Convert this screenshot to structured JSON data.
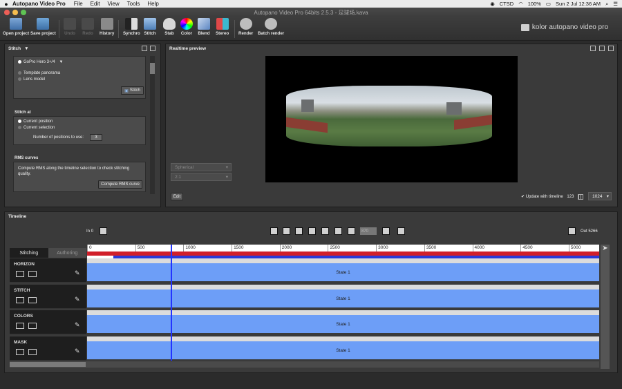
{
  "menubar": {
    "app_name": "Autopano Video Pro",
    "items": [
      "File",
      "Edit",
      "View",
      "Tools",
      "Help"
    ],
    "status_ctsd": "CTSD",
    "battery": "100%",
    "clock": "Sun 2 Jul  12:36 AM"
  },
  "window_title": "Autopano Video Pro 64bits 2.5.3 - 足球场.kava",
  "toolbar": {
    "open_project": "Open project",
    "save_project": "Save project",
    "undo": "Undo",
    "redo": "Redo",
    "history": "History",
    "synchro": "Synchro",
    "stitch": "Stitch",
    "stab": "Stab",
    "color": "Color",
    "blend": "Blend",
    "stereo": "Stereo",
    "render": "Render",
    "batch_render": "Batch render",
    "brand": "kolor autopano video pro"
  },
  "stitch_panel": {
    "title": "Stitch",
    "preset": "GoPro Hero 3+/4",
    "template_panorama": "Template panorama",
    "lens_model": "Lens model",
    "stitch_button": "Stitch",
    "stitch_at_title": "Stitch at",
    "current_position": "Current position",
    "current_selection": "Current selection",
    "num_positions_label": "Number of positions to use:",
    "num_positions_value": "3",
    "rms_title": "RMS curves",
    "rms_desc": "Compute RMS along the timeline selection to check stitching quality.",
    "rms_button": "Compute RMS curve"
  },
  "preview_panel": {
    "title": "Realtime preview",
    "projection": "Spherical",
    "ratio": "2:1",
    "edit_button": "Edit",
    "update_label": "Update with timeline",
    "update_value": "123",
    "resolution": "1024"
  },
  "timeline": {
    "title": "Timeline",
    "in_label": "In",
    "in_value": "0",
    "out_label": "Out",
    "out_value": "5266",
    "frame_value": "870",
    "tab_stitching": "Stitching",
    "tab_authoring": "Authoring",
    "ruler": [
      "0",
      "500",
      "1000",
      "1500",
      "2000",
      "2500",
      "3000",
      "3500",
      "4000",
      "4500",
      "5000"
    ],
    "tracks": [
      {
        "name": "HORIZON",
        "state": "State 1"
      },
      {
        "name": "STITCH",
        "state": "State 1"
      },
      {
        "name": "COLORS",
        "state": "State 1"
      },
      {
        "name": "MASK",
        "state": "State 1"
      }
    ],
    "playhead_frame": 870,
    "total_frames": 5266
  },
  "colors": {
    "state_blue": "#6d9ef7",
    "selection_red": "#d11f2a",
    "selection_blue": "#2b3ad8",
    "playhead": "#2233ff"
  }
}
